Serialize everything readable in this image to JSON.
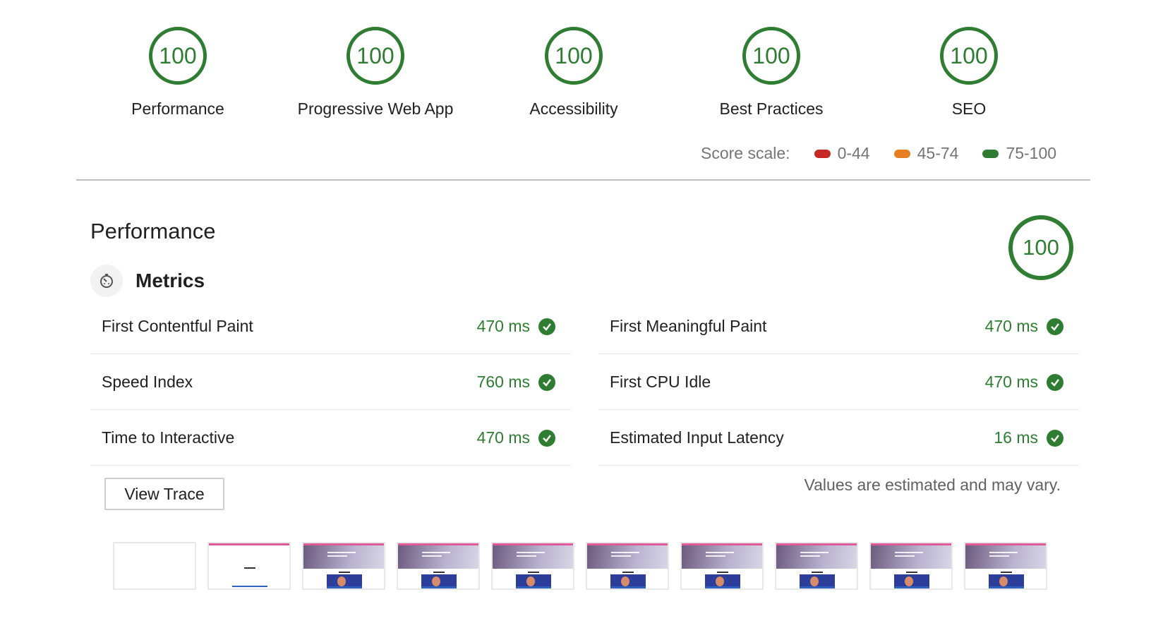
{
  "gauges": [
    {
      "score": "100",
      "label": "Performance"
    },
    {
      "score": "100",
      "label": "Progressive Web App"
    },
    {
      "score": "100",
      "label": "Accessibility"
    },
    {
      "score": "100",
      "label": "Best Practices"
    },
    {
      "score": "100",
      "label": "SEO"
    }
  ],
  "score_scale": {
    "label": "Score scale:",
    "ranges": [
      {
        "text": "0-44",
        "color": "#c62828"
      },
      {
        "text": "45-74",
        "color": "#e67e22"
      },
      {
        "text": "75-100",
        "color": "#2e7d32"
      }
    ]
  },
  "performance": {
    "title": "Performance",
    "score": "100",
    "metrics_title": "Metrics",
    "metrics": [
      {
        "name": "First Contentful Paint",
        "value": "470 ms"
      },
      {
        "name": "First Meaningful Paint",
        "value": "470 ms"
      },
      {
        "name": "Speed Index",
        "value": "760 ms"
      },
      {
        "name": "First CPU Idle",
        "value": "470 ms"
      },
      {
        "name": "Time to Interactive",
        "value": "470 ms"
      },
      {
        "name": "Estimated Input Latency",
        "value": "16 ms"
      }
    ],
    "view_trace_label": "View Trace",
    "note": "Values are estimated and may vary."
  },
  "colors": {
    "pass": "#2e7d32",
    "divider": "#bdbdbd"
  }
}
